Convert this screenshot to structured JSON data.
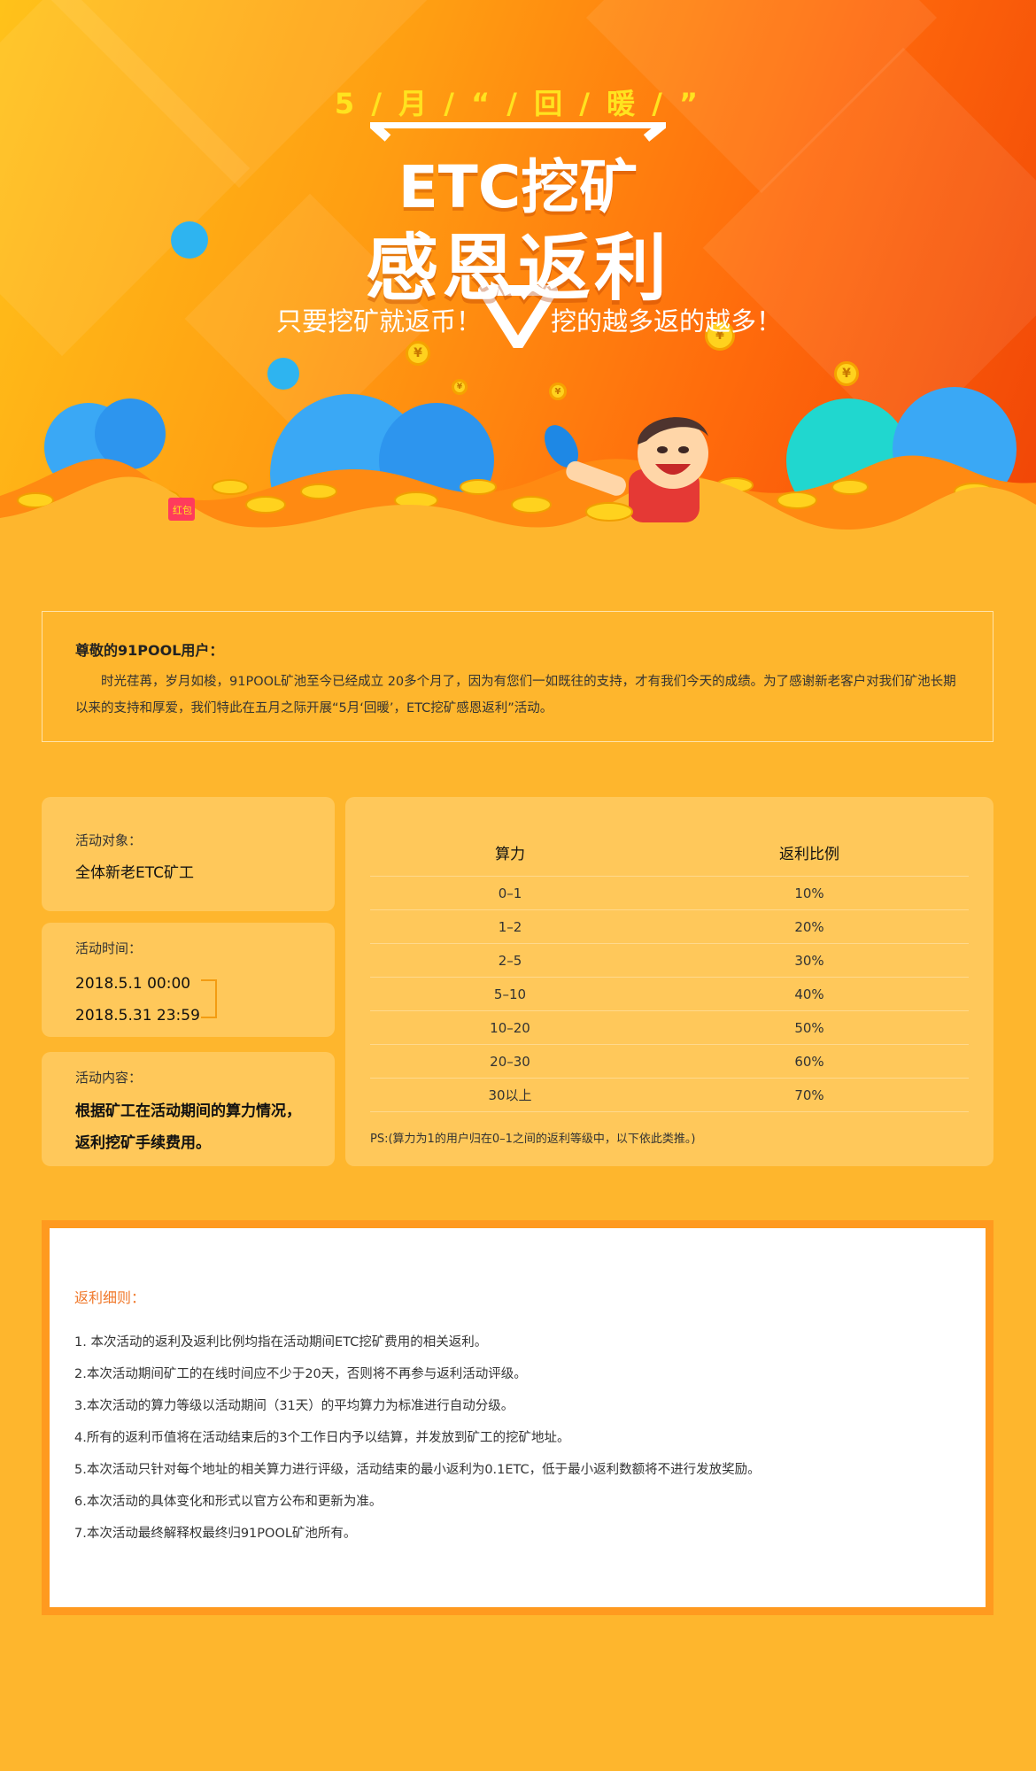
{
  "hero": {
    "subtitle": "5 / 月 / “ / 回 / 暖 / ”",
    "title_line1": "ETC挖矿",
    "title_line2": "感恩返利",
    "tagline_left": "只要挖矿就返币！",
    "tagline_right": "挖的越多返的越多！",
    "coin_symbol": "¥",
    "red_packet_label": "红包"
  },
  "intro": {
    "greeting": "尊敬的91POOL用户：",
    "body": "时光荏苒，岁月如梭，91POOL矿池至今已经成立 20多个月了，因为有您们一如既往的支持，才有我们今天的成绩。为了感谢新老客户对我们矿池长期以来的支持和厚爱，我们特此在五月之际开展“5月‘回暖’，ETC挖矿感恩返利”活动。"
  },
  "cards": {
    "target_label": "活动对象：",
    "target_value": "全体新老ETC矿工",
    "time_label": "活动时间：",
    "time_start": "2018.5.1 00:00",
    "time_end": "2018.5.31 23:59",
    "content_label": "活动内容：",
    "content_line1": "根据矿工在活动期间的算力情况，",
    "content_line2": "返利挖矿手续费用。"
  },
  "rebate_table": {
    "col_hashrate": "算力",
    "col_ratio": "返利比例",
    "rows": [
      {
        "hashrate": "0–1",
        "ratio": "10%"
      },
      {
        "hashrate": "1–2",
        "ratio": "20%"
      },
      {
        "hashrate": "2–5",
        "ratio": "30%"
      },
      {
        "hashrate": "5–10",
        "ratio": "40%"
      },
      {
        "hashrate": "10–20",
        "ratio": "50%"
      },
      {
        "hashrate": "20–30",
        "ratio": "60%"
      },
      {
        "hashrate": "30以上",
        "ratio": "70%"
      }
    ],
    "note": "PS:(算力为1的用户归在0–1之间的返利等级中，以下依此类推。)"
  },
  "rules": {
    "title": "返利细则：",
    "items": [
      "1. 本次活动的返利及返利比例均指在活动期间ETC挖矿费用的相关返利。",
      "2.本次活动期间矿工的在线时间应不少于20天，否则将不再参与返利活动评级。",
      "3.本次活动的算力等级以活动期间（31天）的平均算力为标准进行自动分级。",
      "4.所有的返利币值将在活动结束后的3个工作日内予以结算，并发放到矿工的挖矿地址。",
      "5.本次活动只针对每个地址的相关算力进行评级，活动结束的最小返利为0.1ETC，低于最小返利数额将不进行发放奖励。",
      "6.本次活动的具体变化和形式以官方公布和更新为准。",
      "7.本次活动最终解释权最终归91POOL矿池所有。"
    ]
  },
  "colors": {
    "page_bg": "#feb62d",
    "card_bg": "#ffc85a",
    "rules_border": "#ff9a1f",
    "rules_title": "#f0782a",
    "hero_yellow_text": "#ffe31f"
  }
}
